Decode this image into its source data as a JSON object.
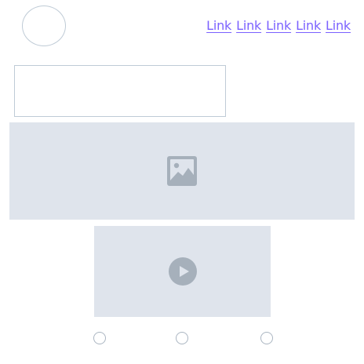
{
  "header": {
    "nav_links": [
      "Link",
      "Link",
      "Link",
      "Link",
      "Link"
    ]
  },
  "media": {
    "image_icon": "image-icon",
    "video_icon": "play-icon"
  },
  "carousel": {
    "dot_count": 3,
    "active_index": null
  },
  "colors": {
    "link": "#7b61ff",
    "placeholder_bg": "#dfe4ec",
    "border": "#bfcbd6",
    "icon": "#a6b0bb"
  }
}
